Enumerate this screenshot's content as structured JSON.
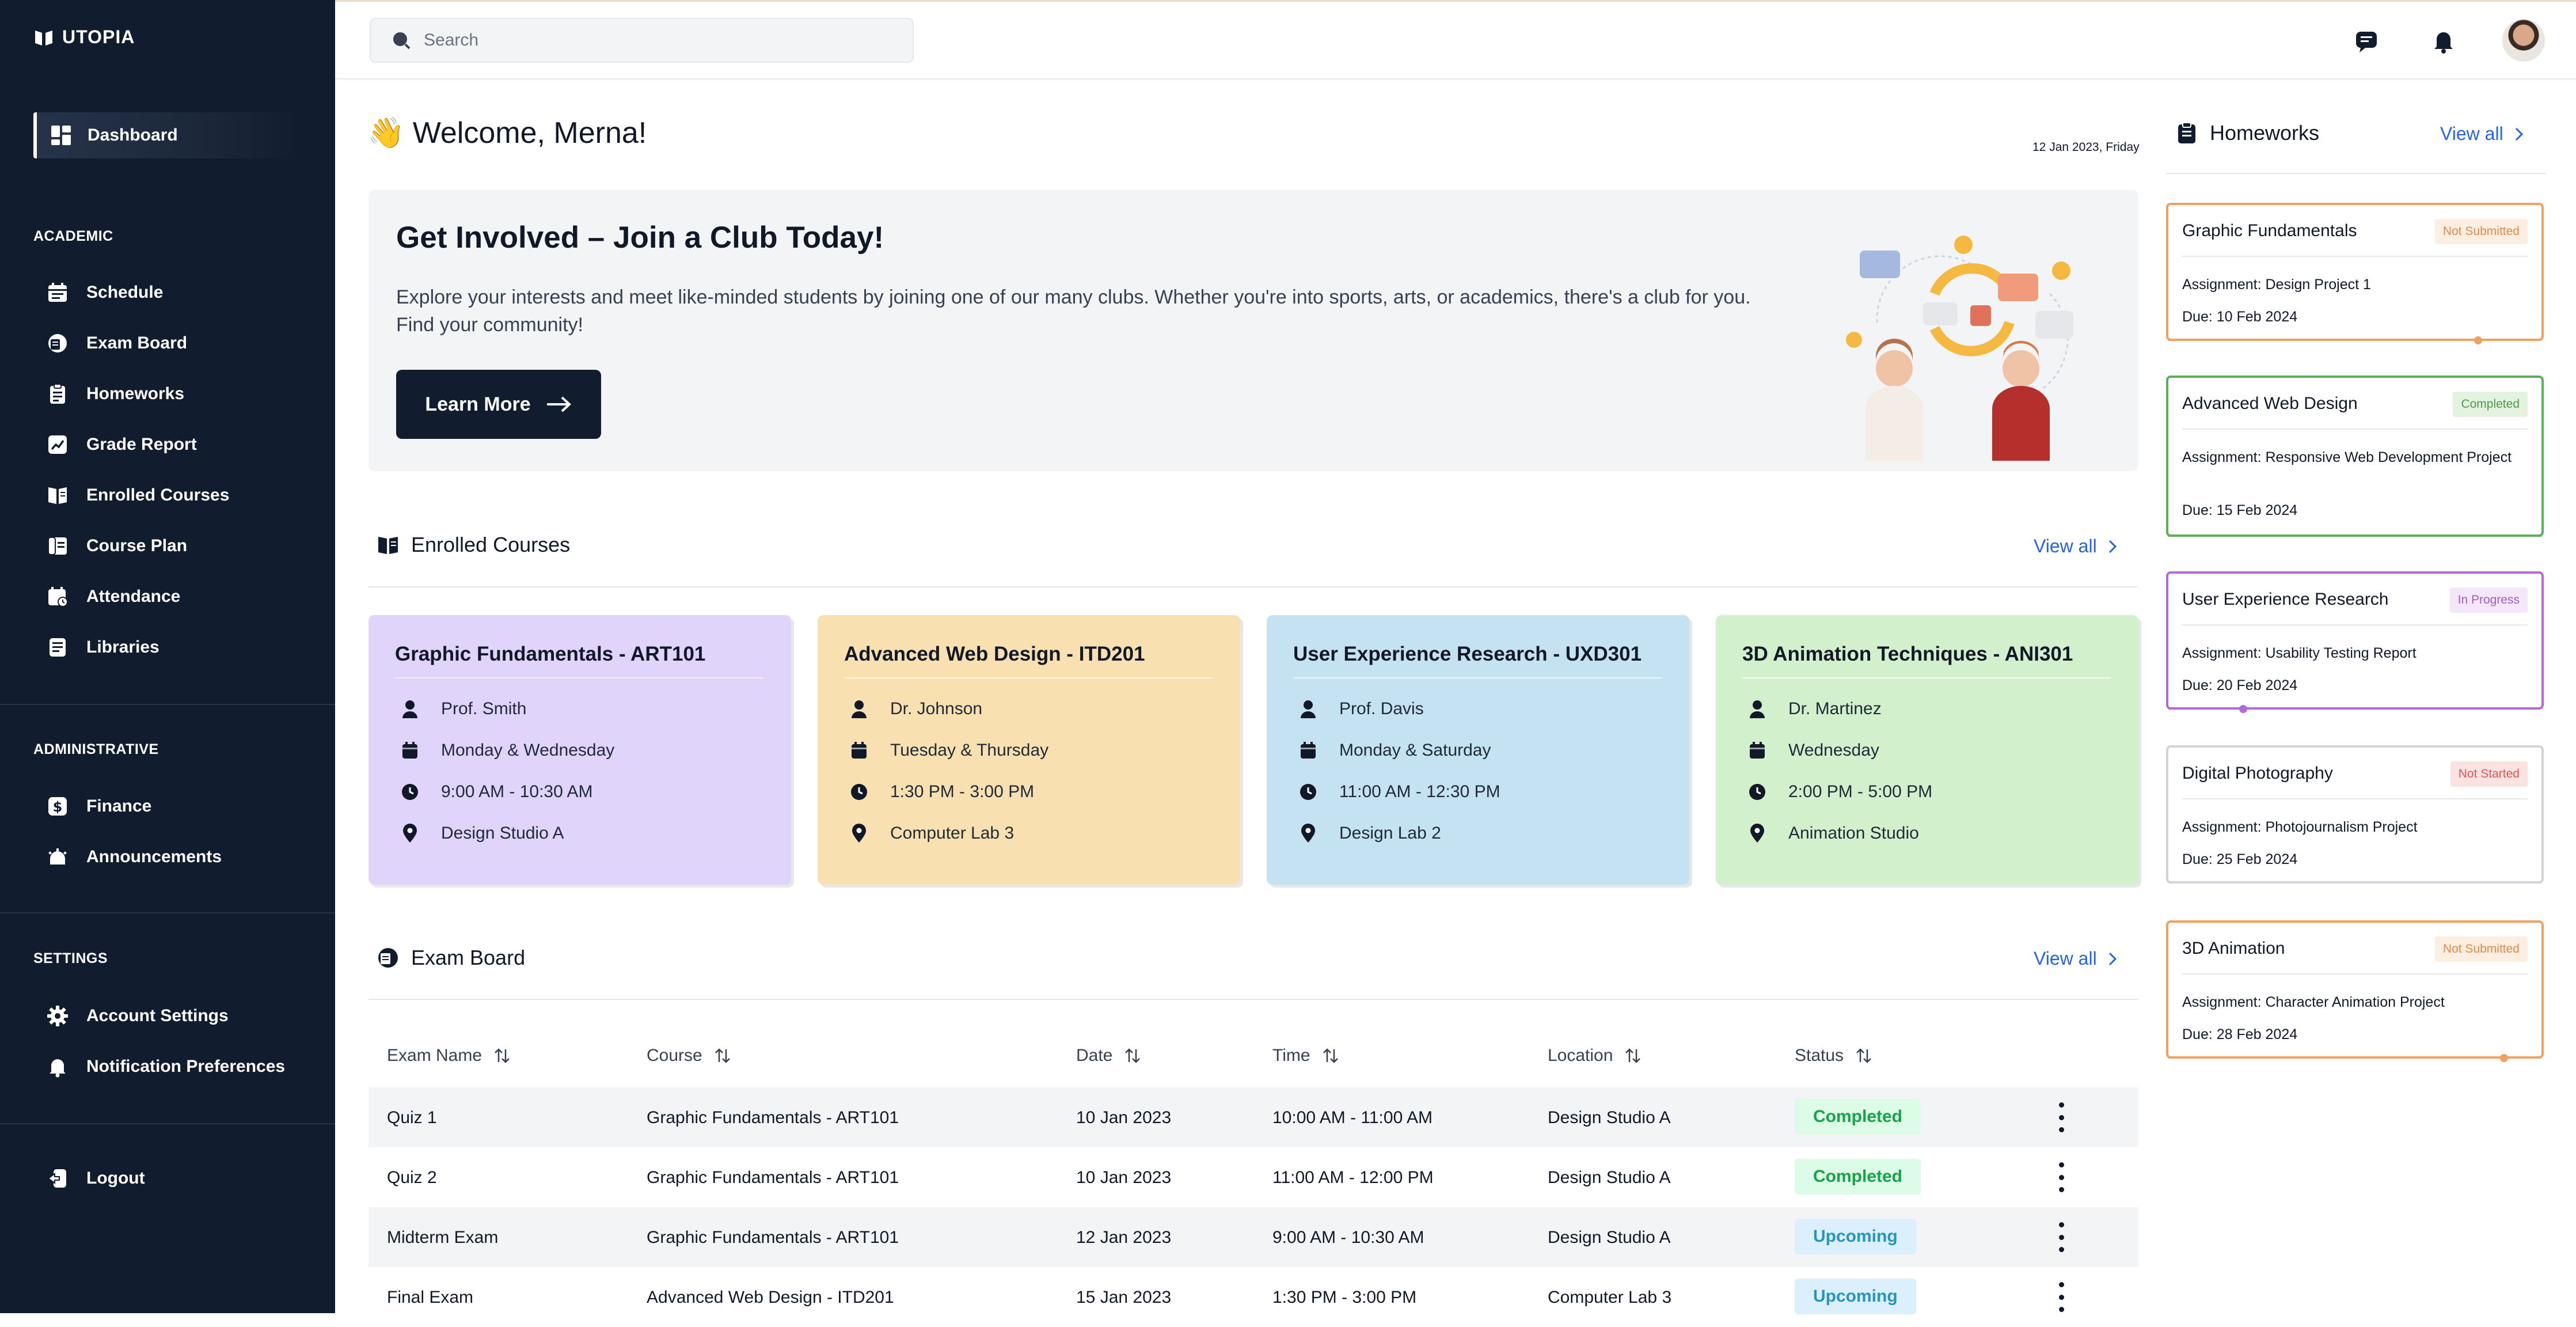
{
  "app": {
    "name": "UTOPIA"
  },
  "sidebar": {
    "active": {
      "label": "Dashboard",
      "icon": "dashboard-icon"
    },
    "academic_title": "ACADEMIC",
    "academic": [
      {
        "label": "Schedule",
        "icon": "calendar-icon"
      },
      {
        "label": "Exam Board",
        "icon": "exam-board-icon"
      },
      {
        "label": "Homeworks",
        "icon": "clipboard-icon"
      },
      {
        "label": "Grade Report",
        "icon": "chart-icon"
      },
      {
        "label": "Enrolled Courses",
        "icon": "book-icon"
      },
      {
        "label": "Course Plan",
        "icon": "plan-icon"
      },
      {
        "label": "Attendance",
        "icon": "attendance-icon"
      },
      {
        "label": "Libraries",
        "icon": "library-icon"
      }
    ],
    "administrative_title": "ADMINISTRATIVE",
    "administrative": [
      {
        "label": "Finance",
        "icon": "dollar-icon"
      },
      {
        "label": "Announcements",
        "icon": "announcement-icon"
      }
    ],
    "settings_title": "SETTINGS",
    "settings": [
      {
        "label": "Account Settings",
        "icon": "gear-icon"
      },
      {
        "label": "Notification Preferences",
        "icon": "bell-icon"
      }
    ],
    "logout": "Logout"
  },
  "topbar": {
    "search_placeholder": "Search"
  },
  "welcome": {
    "emoji": "👋",
    "text": "Welcome, Merna!",
    "date": "12 Jan 2023, Friday"
  },
  "banner": {
    "title": "Get Involved – Join a Club Today!",
    "body": "Explore your interests and meet like-minded students by joining one of our many clubs. Whether you're into sports, arts, or academics, there's a club for you. Find your community!",
    "button": "Learn More"
  },
  "enrolled": {
    "title": "Enrolled Courses",
    "view_all": "View all",
    "courses": [
      {
        "title": "Graphic Fundamentals - ART101",
        "instructor": "Prof. Smith",
        "days": "Monday & Wednesday",
        "time": "9:00 AM - 10:30 AM",
        "location": "Design Studio A",
        "color": "#e0d4fb"
      },
      {
        "title": "Advanced Web Design - ITD201",
        "instructor": "Dr. Johnson",
        "days": "Tuesday & Thursday",
        "time": "1:30 PM - 3:00 PM",
        "location": "Computer Lab 3",
        "color": "#f9e0b0"
      },
      {
        "title": "User Experience Research - UXD301",
        "instructor": "Prof. Davis",
        "days": "Monday & Saturday",
        "time": "11:00 AM - 12:30 PM",
        "location": "Design Lab 2",
        "color": "#c4e2f1"
      },
      {
        "title": "3D Animation Techniques - ANI301",
        "instructor": "Dr. Martinez",
        "days": "Wednesday",
        "time": "2:00 PM - 5:00 PM",
        "location": "Animation Studio",
        "color": "#d3f0cd"
      }
    ]
  },
  "exams": {
    "title": "Exam Board",
    "view_all": "View all",
    "columns": [
      "Exam Name",
      "Course",
      "Date",
      "Time",
      "Location",
      "Status"
    ],
    "rows": [
      {
        "name": "Quiz 1",
        "course": "Graphic Fundamentals - ART101",
        "date": "10 Jan 2023",
        "time": "10:00 AM - 11:00 AM",
        "location": "Design Studio A",
        "status": "Completed"
      },
      {
        "name": "Quiz 2",
        "course": "Graphic Fundamentals - ART101",
        "date": "10 Jan 2023",
        "time": "11:00 AM - 12:00 PM",
        "location": "Design Studio A",
        "status": "Completed"
      },
      {
        "name": "Midterm Exam",
        "course": "Graphic Fundamentals - ART101",
        "date": "12 Jan 2023",
        "time": "9:00 AM - 10:30 AM",
        "location": "Design Studio A",
        "status": "Upcoming"
      },
      {
        "name": "Final Exam",
        "course": "Advanced Web Design - ITD201",
        "date": "15 Jan 2023",
        "time": "1:30 PM - 3:00 PM",
        "location": "Computer Lab 3",
        "status": "Upcoming"
      }
    ]
  },
  "homeworks": {
    "title": "Homeworks",
    "view_all": "View all",
    "items": [
      {
        "title": "Graphic Fundamentals",
        "status": "Not Submitted",
        "assignment": "Assignment: Design Project 1",
        "due": "Due: 10 Feb 2024",
        "color": "#f0a060",
        "badge_bg": "#fdeee2",
        "badge_fg": "#e08a4a",
        "progress": 0.83
      },
      {
        "title": "Advanced Web Design",
        "status": "Completed",
        "assignment": "Assignment: Responsive Web Development Project",
        "due": "Due: 15 Feb 2024",
        "color": "#5fae5a",
        "badge_bg": "#e3f3df",
        "badge_fg": "#4f9a4a",
        "progress": 1.0
      },
      {
        "title": "User Experience Research",
        "status": "In Progress",
        "assignment": "Assignment: Usability Testing Report",
        "due": "Due: 20 Feb 2024",
        "color": "#b36ad8",
        "badge_bg": "#f4e6fb",
        "badge_fg": "#a35bc8",
        "progress": 0.2
      },
      {
        "title": "Digital Photography",
        "status": "Not Started",
        "assignment": "Assignment: Photojournalism Project",
        "due": "Due: 25 Feb 2024",
        "color": "#d1d5db",
        "badge_bg": "#fde2e2",
        "badge_fg": "#e05555",
        "progress": 0
      },
      {
        "title": "3D Animation",
        "status": "Not Submitted",
        "assignment": "Assignment: Character Animation Project",
        "due": "Due: 28 Feb 2024",
        "color": "#f0a060",
        "badge_bg": "#fdeee2",
        "badge_fg": "#e08a4a",
        "progress": 0.9
      }
    ]
  }
}
